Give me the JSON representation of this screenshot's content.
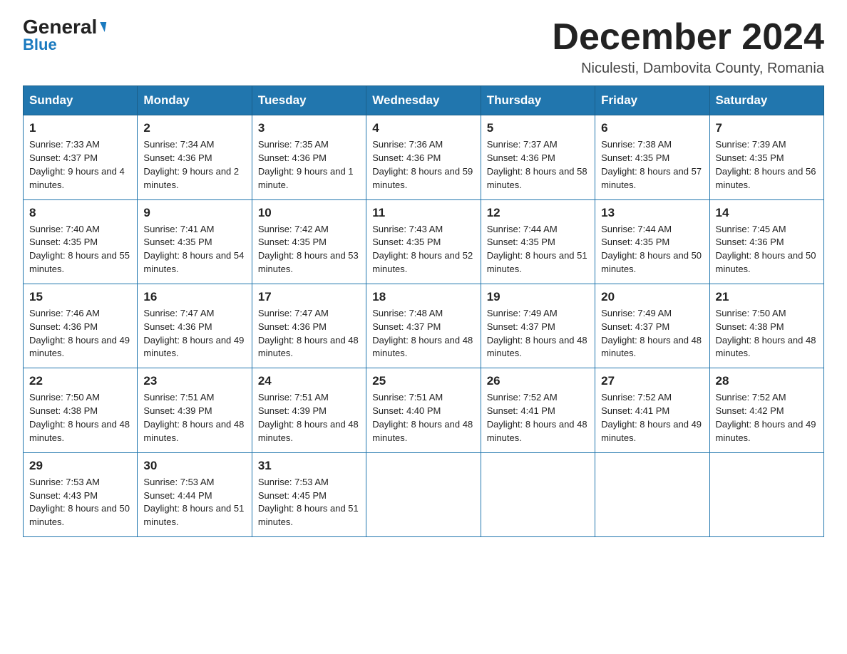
{
  "header": {
    "logo_general": "General",
    "logo_blue": "Blue",
    "month_year": "December 2024",
    "location": "Niculesti, Dambovita County, Romania"
  },
  "days_of_week": [
    "Sunday",
    "Monday",
    "Tuesday",
    "Wednesday",
    "Thursday",
    "Friday",
    "Saturday"
  ],
  "weeks": [
    [
      {
        "day": "1",
        "sunrise": "7:33 AM",
        "sunset": "4:37 PM",
        "daylight": "9 hours and 4 minutes."
      },
      {
        "day": "2",
        "sunrise": "7:34 AM",
        "sunset": "4:36 PM",
        "daylight": "9 hours and 2 minutes."
      },
      {
        "day": "3",
        "sunrise": "7:35 AM",
        "sunset": "4:36 PM",
        "daylight": "9 hours and 1 minute."
      },
      {
        "day": "4",
        "sunrise": "7:36 AM",
        "sunset": "4:36 PM",
        "daylight": "8 hours and 59 minutes."
      },
      {
        "day": "5",
        "sunrise": "7:37 AM",
        "sunset": "4:36 PM",
        "daylight": "8 hours and 58 minutes."
      },
      {
        "day": "6",
        "sunrise": "7:38 AM",
        "sunset": "4:35 PM",
        "daylight": "8 hours and 57 minutes."
      },
      {
        "day": "7",
        "sunrise": "7:39 AM",
        "sunset": "4:35 PM",
        "daylight": "8 hours and 56 minutes."
      }
    ],
    [
      {
        "day": "8",
        "sunrise": "7:40 AM",
        "sunset": "4:35 PM",
        "daylight": "8 hours and 55 minutes."
      },
      {
        "day": "9",
        "sunrise": "7:41 AM",
        "sunset": "4:35 PM",
        "daylight": "8 hours and 54 minutes."
      },
      {
        "day": "10",
        "sunrise": "7:42 AM",
        "sunset": "4:35 PM",
        "daylight": "8 hours and 53 minutes."
      },
      {
        "day": "11",
        "sunrise": "7:43 AM",
        "sunset": "4:35 PM",
        "daylight": "8 hours and 52 minutes."
      },
      {
        "day": "12",
        "sunrise": "7:44 AM",
        "sunset": "4:35 PM",
        "daylight": "8 hours and 51 minutes."
      },
      {
        "day": "13",
        "sunrise": "7:44 AM",
        "sunset": "4:35 PM",
        "daylight": "8 hours and 50 minutes."
      },
      {
        "day": "14",
        "sunrise": "7:45 AM",
        "sunset": "4:36 PM",
        "daylight": "8 hours and 50 minutes."
      }
    ],
    [
      {
        "day": "15",
        "sunrise": "7:46 AM",
        "sunset": "4:36 PM",
        "daylight": "8 hours and 49 minutes."
      },
      {
        "day": "16",
        "sunrise": "7:47 AM",
        "sunset": "4:36 PM",
        "daylight": "8 hours and 49 minutes."
      },
      {
        "day": "17",
        "sunrise": "7:47 AM",
        "sunset": "4:36 PM",
        "daylight": "8 hours and 48 minutes."
      },
      {
        "day": "18",
        "sunrise": "7:48 AM",
        "sunset": "4:37 PM",
        "daylight": "8 hours and 48 minutes."
      },
      {
        "day": "19",
        "sunrise": "7:49 AM",
        "sunset": "4:37 PM",
        "daylight": "8 hours and 48 minutes."
      },
      {
        "day": "20",
        "sunrise": "7:49 AM",
        "sunset": "4:37 PM",
        "daylight": "8 hours and 48 minutes."
      },
      {
        "day": "21",
        "sunrise": "7:50 AM",
        "sunset": "4:38 PM",
        "daylight": "8 hours and 48 minutes."
      }
    ],
    [
      {
        "day": "22",
        "sunrise": "7:50 AM",
        "sunset": "4:38 PM",
        "daylight": "8 hours and 48 minutes."
      },
      {
        "day": "23",
        "sunrise": "7:51 AM",
        "sunset": "4:39 PM",
        "daylight": "8 hours and 48 minutes."
      },
      {
        "day": "24",
        "sunrise": "7:51 AM",
        "sunset": "4:39 PM",
        "daylight": "8 hours and 48 minutes."
      },
      {
        "day": "25",
        "sunrise": "7:51 AM",
        "sunset": "4:40 PM",
        "daylight": "8 hours and 48 minutes."
      },
      {
        "day": "26",
        "sunrise": "7:52 AM",
        "sunset": "4:41 PM",
        "daylight": "8 hours and 48 minutes."
      },
      {
        "day": "27",
        "sunrise": "7:52 AM",
        "sunset": "4:41 PM",
        "daylight": "8 hours and 49 minutes."
      },
      {
        "day": "28",
        "sunrise": "7:52 AM",
        "sunset": "4:42 PM",
        "daylight": "8 hours and 49 minutes."
      }
    ],
    [
      {
        "day": "29",
        "sunrise": "7:53 AM",
        "sunset": "4:43 PM",
        "daylight": "8 hours and 50 minutes."
      },
      {
        "day": "30",
        "sunrise": "7:53 AM",
        "sunset": "4:44 PM",
        "daylight": "8 hours and 51 minutes."
      },
      {
        "day": "31",
        "sunrise": "7:53 AM",
        "sunset": "4:45 PM",
        "daylight": "8 hours and 51 minutes."
      },
      null,
      null,
      null,
      null
    ]
  ]
}
